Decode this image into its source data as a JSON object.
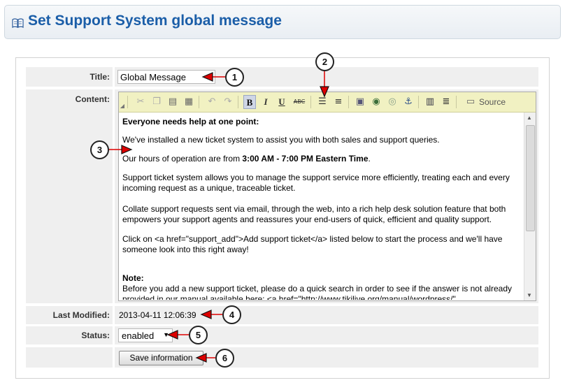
{
  "header": {
    "title": "Set Support System global message",
    "icon": "book-icon"
  },
  "form": {
    "title_label": "Title:",
    "title_value": "Global Message",
    "content_label": "Content:",
    "last_modified_label": "Last Modified:",
    "last_modified_value": "2013-04-11 12:06:39",
    "status_label": "Status:",
    "status_value": "enabled",
    "save_button": "Save information"
  },
  "toolbar": {
    "source_label": "Source",
    "buttons": [
      "collapse-icon",
      "cut-icon",
      "copy-icon",
      "paste-icon",
      "paste-text-icon",
      "undo-icon",
      "redo-icon",
      "bold-icon",
      "italic-icon",
      "underline-icon",
      "strikethrough-icon",
      "numbered-list-icon",
      "bulleted-list-icon",
      "image-icon",
      "link-icon",
      "unlink-icon",
      "anchor-icon",
      "table-icon",
      "horizontal-rule-icon",
      "source-icon"
    ]
  },
  "content": {
    "heading": "Everyone needs help at one point:",
    "p1": "We've installed a new ticket system to assist you with both sales and support queries.",
    "p2_prefix": "Our hours of operation are from ",
    "p2_bold": "3:00 AM - 7:00 PM Eastern Time",
    "p2_suffix": ".",
    "p3": "Support ticket system allows you to manage the  support service more efficiently, treating each and every incoming request as a unique, traceable ticket.",
    "p4": "Collate support requests sent via email, through the web, into a rich help desk solution feature that both empowers your support agents and reassures your end-users of quick, efficient and quality support.",
    "p5": "Click on <a href=\"support_add\">Add support ticket</a> listed below to start the process and we'll have someone look into this right away!",
    "note_heading": "Note:",
    "note_text": "Before you add a new support ticket, please do a quick search in order to see if the answer is not already provided in our manual available here: <a href=\"http://www.tikilive.org/manual/wordpress/\""
  },
  "callouts": [
    "1",
    "2",
    "3",
    "4",
    "5",
    "6"
  ],
  "colors": {
    "title_blue": "#1b5ea8",
    "toolbar_bg": "#f1f1c2",
    "arrow_red": "#dd0000"
  }
}
